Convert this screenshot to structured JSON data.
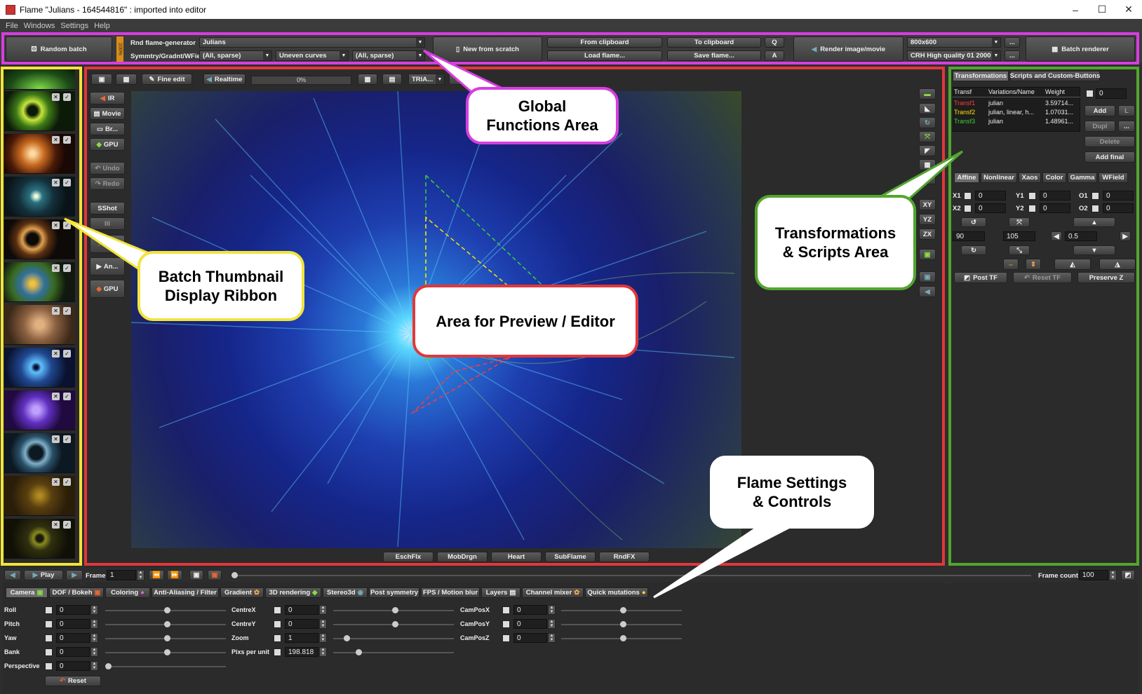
{
  "window": {
    "title": "Flame \"Julians - 164544816\" : imported into editor",
    "minimize": "–",
    "maximize": "☐",
    "close": "✕"
  },
  "menu": [
    "File",
    "Windows",
    "Settings",
    "Help"
  ],
  "toolbar": {
    "random_batch": "Random batch",
    "progress_label": "100%",
    "rnd_generator_label": "Rnd flame-generator",
    "rnd_generator_value": "Julians",
    "symmetry_label": "Symmtry/Gradnt/WField",
    "symmetry_value": "(All, sparse)",
    "gradient_value": "Uneven curves",
    "wfield_value": "(All, sparse)",
    "new_from_scratch": "New from scratch",
    "from_clipboard": "From clipboard",
    "load_flame": "Load flame...",
    "to_clipboard": "To clipboard",
    "save_flame": "Save flame...",
    "q": "Q",
    "a": "A",
    "render_image": "Render image/movie",
    "resolution_value": "800x600",
    "quality_value": "CRH High quality 01 2000",
    "dots": "...",
    "batch_renderer": "Batch renderer"
  },
  "editor_toolbar": {
    "fine_edit": "Fine edit",
    "realtime": "Realtime",
    "progress": "0%",
    "tria": "TRIA..."
  },
  "left_buttons": [
    "IR",
    "Movie",
    "Br...",
    "GPU",
    "Undo",
    "Redo",
    "SShot",
    "Ill",
    "So...",
    "An...",
    "GPU"
  ],
  "right_axis_buttons": [
    "XY",
    "YZ",
    "ZX"
  ],
  "bottom_preview_buttons": [
    "EschFlx",
    "MobDrgn",
    "Heart",
    "SubFlame",
    "RndFX"
  ],
  "transforms": {
    "tabs": [
      "Transformations",
      "Scripts and Custom-Buttons"
    ],
    "columns": [
      "Transf",
      "Variations/Name",
      "Weight"
    ],
    "rows": [
      {
        "name": "Transf1",
        "vars": "julian",
        "weight": "3.59714...",
        "color": "#ff3b3b"
      },
      {
        "name": "Transf2",
        "vars": "julian, linear, h...",
        "weight": "1.07031...",
        "color": "#ffe000"
      },
      {
        "name": "Transf3",
        "vars": "julian",
        "weight": "1.48961...",
        "color": "#3bd13b"
      }
    ],
    "count_value": "0",
    "add": "Add",
    "l": "L",
    "dupl": "Dupl",
    "dots": "...",
    "delete": "Delete",
    "add_final": "Add final",
    "sub_tabs": [
      "Affine",
      "Nonlinear",
      "Xaos",
      "Color",
      "Gamma",
      "WField"
    ],
    "x1": "X1",
    "y1": "Y1",
    "o1": "O1",
    "x2": "X2",
    "y2": "Y2",
    "o2": "O2",
    "zero": "0",
    "rot_value": "90",
    "angle_value": "105",
    "step_value": "0.5",
    "post_tf": "Post TF",
    "reset_tf": "Reset TF",
    "preserve_z": "Preserve Z"
  },
  "timeline": {
    "play": "Play",
    "frame_label": "Frame",
    "frame_value": "1",
    "frame_count_label": "Frame count",
    "frame_count_value": "100"
  },
  "settings_tabs": [
    "Camera",
    "DOF / Bokeh",
    "Coloring",
    "Anti-Aliasing / Filter",
    "Gradient",
    "3D rendering",
    "Stereo3d",
    "Post symmetry",
    "FPS / Motion blur",
    "Layers",
    "Channel mixer",
    "Quick mutations"
  ],
  "camera": {
    "col1": [
      {
        "label": "Roll",
        "value": "0"
      },
      {
        "label": "Pitch",
        "value": "0"
      },
      {
        "label": "Yaw",
        "value": "0"
      },
      {
        "label": "Bank",
        "value": "0"
      },
      {
        "label": "Perspective",
        "value": "0"
      }
    ],
    "col2": [
      {
        "label": "CentreX",
        "value": "0"
      },
      {
        "label": "CentreY",
        "value": "0"
      },
      {
        "label": "Zoom",
        "value": "1"
      },
      {
        "label": "Pixs per unit",
        "value": "198.818"
      }
    ],
    "col3": [
      {
        "label": "CamPosX",
        "value": "0"
      },
      {
        "label": "CamPosY",
        "value": "0"
      },
      {
        "label": "CamPosZ",
        "value": "0"
      }
    ],
    "reset": "Reset"
  },
  "callouts": {
    "global": "Global\nFunctions Area",
    "batch": "Batch Thumbnail\nDisplay Ribbon",
    "preview": "Area for Preview / Editor",
    "transforms": "Transformations\n& Scripts Area",
    "settings": "Flame Settings\n& Controls"
  },
  "colors": {
    "global": "#d63ee0",
    "batch": "#f2e43a",
    "preview": "#e0383a",
    "transforms": "#52a62f"
  }
}
